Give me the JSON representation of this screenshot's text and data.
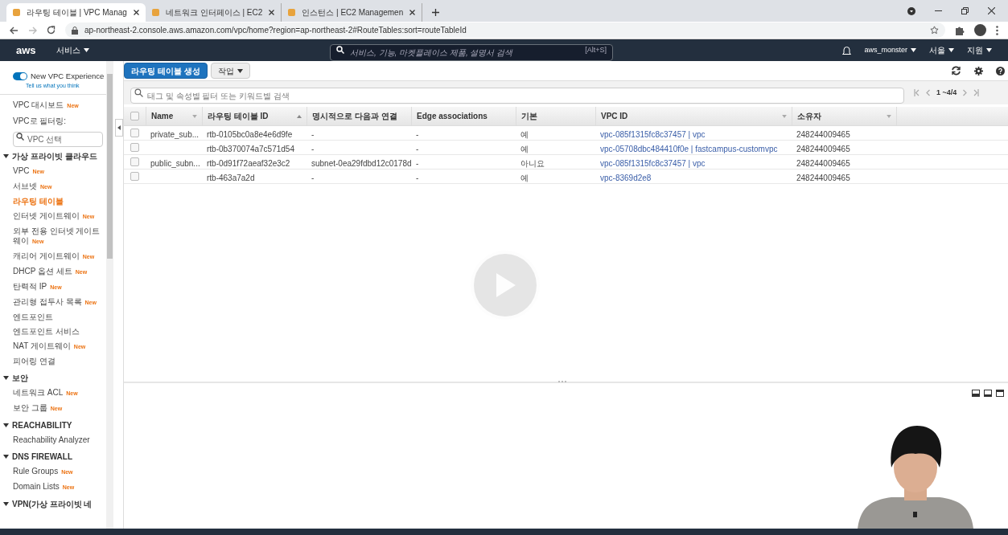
{
  "browser": {
    "tabs": [
      {
        "title": "라우팅 테이블 | VPC Manag",
        "selected": true
      },
      {
        "title": "네트워크 인터페이스 | EC2",
        "selected": false
      },
      {
        "title": "인스턴스 | EC2 Managemen",
        "selected": false
      }
    ],
    "url": "ap-northeast-2.console.aws.amazon.com/vpc/home?region=ap-northeast-2#RouteTables:sort=routeTableId"
  },
  "aws_nav": {
    "logo": "aws",
    "services": "서비스",
    "search": {
      "placeholder": "서비스, 기능, 마켓플레이스 제품, 설명서 검색",
      "shortcut": "[Alt+S]"
    },
    "user": "aws_monster",
    "region": "서울",
    "support": "지원"
  },
  "sidebar": {
    "toggle": {
      "label": "New VPC Experience",
      "on": true
    },
    "feedback": "Tell us what you think",
    "items": [
      {
        "kind": "link",
        "label": "VPC 대시보드",
        "badge": "New",
        "selected": false
      },
      {
        "kind": "label",
        "label": "VPC로 필터링:"
      },
      {
        "kind": "search",
        "placeholder": "VPC 선택"
      },
      {
        "kind": "section",
        "label": "가상 프라이빗 클라우드",
        "expanded": true,
        "children": [
          {
            "kind": "link",
            "label": "VPC",
            "badge": "New",
            "selected": false
          },
          {
            "kind": "link",
            "label": "서브넷",
            "badge": "New",
            "selected": false
          },
          {
            "kind": "link",
            "label": "라우팅 테이블",
            "selected": true
          },
          {
            "kind": "link",
            "label": "인터넷 게이트웨이",
            "badge": "New",
            "selected": false
          },
          {
            "kind": "link",
            "label": "외부 전용 인터넷 게이트웨이",
            "badge": "New",
            "selected": false
          },
          {
            "kind": "link",
            "label": "캐리어 게이트웨이",
            "badge": "New",
            "selected": false
          },
          {
            "kind": "link",
            "label": "DHCP 옵션 세트",
            "badge": "New",
            "selected": false
          },
          {
            "kind": "link",
            "label": "탄력적 IP",
            "badge": "New",
            "selected": false
          },
          {
            "kind": "link",
            "label": "관리형 접두사 목록",
            "badge": "New",
            "selected": false
          },
          {
            "kind": "link",
            "label": "엔드포인트",
            "selected": false
          },
          {
            "kind": "link",
            "label": "엔드포인트 서비스",
            "selected": false
          },
          {
            "kind": "link",
            "label": "NAT 게이트웨이",
            "badge": "New",
            "selected": false
          },
          {
            "kind": "link",
            "label": "피어링 연결",
            "selected": false
          }
        ]
      },
      {
        "kind": "section",
        "label": "보안",
        "expanded": true,
        "children": [
          {
            "kind": "link",
            "label": "네트워크 ACL",
            "badge": "New",
            "selected": false
          },
          {
            "kind": "link",
            "label": "보안 그룹",
            "badge": "New",
            "selected": false
          }
        ]
      },
      {
        "kind": "section",
        "label": "REACHABILITY",
        "expanded": true,
        "children": [
          {
            "kind": "link",
            "label": "Reachability Analyzer",
            "selected": false
          }
        ]
      },
      {
        "kind": "section",
        "label": "DNS FIREWALL",
        "expanded": true,
        "children": [
          {
            "kind": "link",
            "label": "Rule Groups",
            "badge": "New",
            "selected": false
          },
          {
            "kind": "link",
            "label": "Domain Lists",
            "badge": "New",
            "selected": false
          }
        ]
      },
      {
        "kind": "section",
        "label": "VPN(가상 프라이빗 네",
        "expanded": true
      }
    ]
  },
  "toolbar": {
    "buttons": [
      {
        "kind": "primary",
        "label": "라우팅 테이블 생성"
      },
      {
        "kind": "menu",
        "label": "작업"
      }
    ]
  },
  "filter": {
    "placeholder": "태그 및 속성별 필터 또는 키워드별 검색"
  },
  "pagination": "1 ~4/4",
  "table": {
    "select_all": {
      "checked": false
    },
    "columns": [
      {
        "label": "Name",
        "sorted": false,
        "filterable": true
      },
      {
        "label": "라우팅 테이블 ID",
        "sorted": true,
        "filterable": false
      },
      {
        "label": "명시적으로 다음과 연결",
        "sorted": false,
        "filterable": false
      },
      {
        "label": "Edge associations",
        "sorted": false,
        "filterable": false
      },
      {
        "label": "기본",
        "sorted": false,
        "filterable": false
      },
      {
        "label": "VPC ID",
        "sorted": false,
        "filterable": true
      },
      {
        "label": "소유자",
        "sorted": false,
        "filterable": true
      }
    ],
    "rows": [
      {
        "checked": false,
        "cells": [
          "private_sub...",
          "rtb-0105bc0a8e4e6d9fe",
          "-",
          "-",
          "예",
          "vpc-085f1315fc8c37457 | vpc",
          "248244009465"
        ]
      },
      {
        "checked": false,
        "cells": [
          null,
          "rtb-0b370074a7c571d54",
          "-",
          "-",
          "예",
          "vpc-05708dbc484410f0e | fastcampus-customvpc",
          "248244009465"
        ]
      },
      {
        "checked": false,
        "cells": [
          "public_subn...",
          "rtb-0d91f72aeaf32e3c2",
          "subnet-0ea29fdbd12c0178d",
          "-",
          "아니요",
          "vpc-085f1315fc8c37457 | vpc",
          "248244009465"
        ]
      },
      {
        "checked": false,
        "cells": [
          null,
          "rtb-463a7a2d",
          "-",
          "-",
          "예",
          "vpc-8369d2e8",
          "248244009465"
        ]
      }
    ]
  }
}
